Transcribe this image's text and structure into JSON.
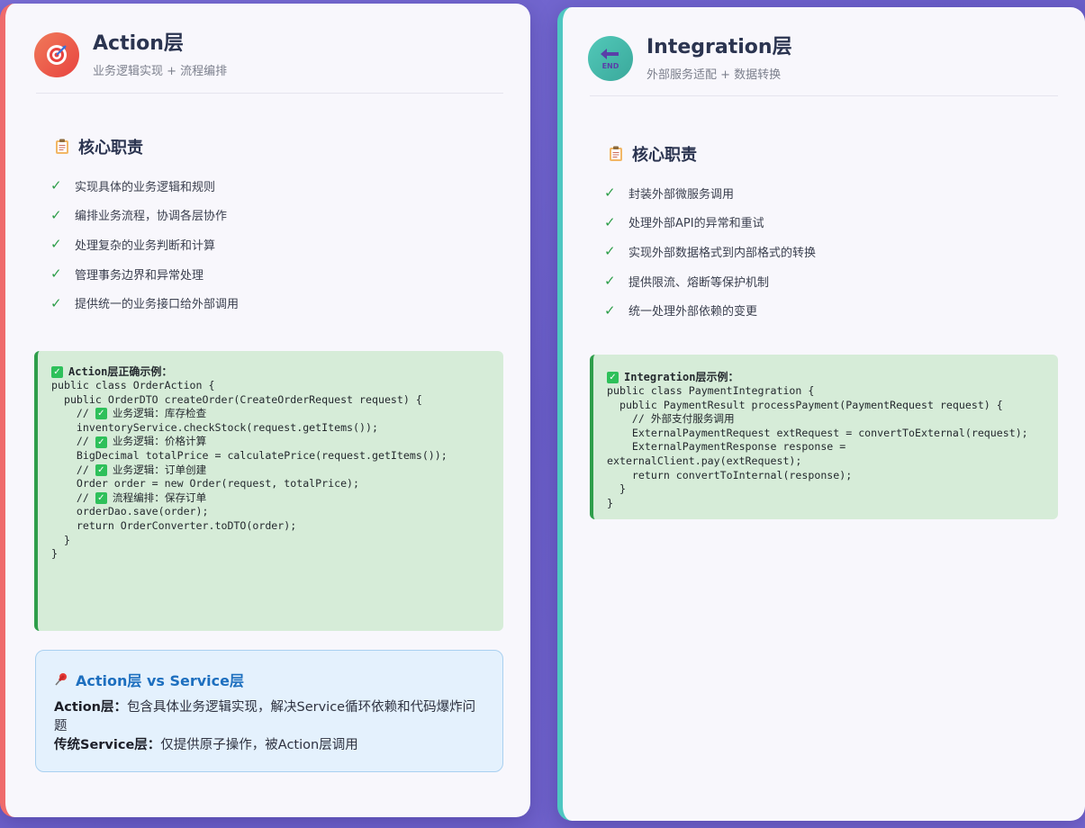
{
  "left_card": {
    "title": "Action层",
    "subtitle": "业务逻辑实现 + 流程编排",
    "icon": "target-icon",
    "accent": "#ef6b6b",
    "duties_title": "核心职责",
    "duties": [
      "实现具体的业务逻辑和规则",
      "编排业务流程，协调各层协作",
      "处理复杂的业务判断和计算",
      "管理事务边界和异常处理",
      "提供统一的业务接口给外部调用"
    ],
    "code_title": "Action层正确示例：",
    "code": {
      "l1": "public class OrderAction {",
      "l2": "  public OrderDTO createOrder(CreateOrderRequest request) {",
      "c1": "业务逻辑：库存检查",
      "l3": "    inventoryService.checkStock(request.getItems());",
      "c2": "业务逻辑：价格计算",
      "l4": "    BigDecimal totalPrice = calculatePrice(request.getItems());",
      "c3": "业务逻辑：订单创建",
      "l5": "    Order order = new Order(request, totalPrice);",
      "c4": "流程编排：保存订单",
      "l6": "    orderDao.save(order);",
      "l7": "    return OrderConverter.toDTO(order);",
      "l8": "  }",
      "l9": "}"
    },
    "note": {
      "title": "Action层 vs Service层",
      "line1_label": "Action层：",
      "line1_text": "包含具体业务逻辑实现，解决Service循环依赖和代码爆炸问题",
      "line2_label": "传统Service层：",
      "line2_text": "仅提供原子操作，被Action层调用"
    }
  },
  "right_card": {
    "title": "Integration层",
    "subtitle": "外部服务适配 + 数据转换",
    "icon": "end-arrow-icon",
    "icon_text": "END",
    "accent": "#4ec7c1",
    "duties_title": "核心职责",
    "duties": [
      "封装外部微服务调用",
      "处理外部API的异常和重试",
      "实现外部数据格式到内部格式的转换",
      "提供限流、熔断等保护机制",
      "统一处理外部依赖的变更"
    ],
    "code_title": "Integration层示例：",
    "code": {
      "l1": "public class PaymentIntegration {",
      "l2": "  public PaymentResult processPayment(PaymentRequest request) {",
      "l3": "    // 外部支付服务调用",
      "l4": "    ExternalPaymentRequest extRequest = convertToExternal(request);",
      "l5": "    ExternalPaymentResponse response =",
      "l6": "externalClient.pay(extRequest);",
      "l7": "    return convertToInternal(response);",
      "l8": "  }",
      "l9": "}"
    }
  }
}
